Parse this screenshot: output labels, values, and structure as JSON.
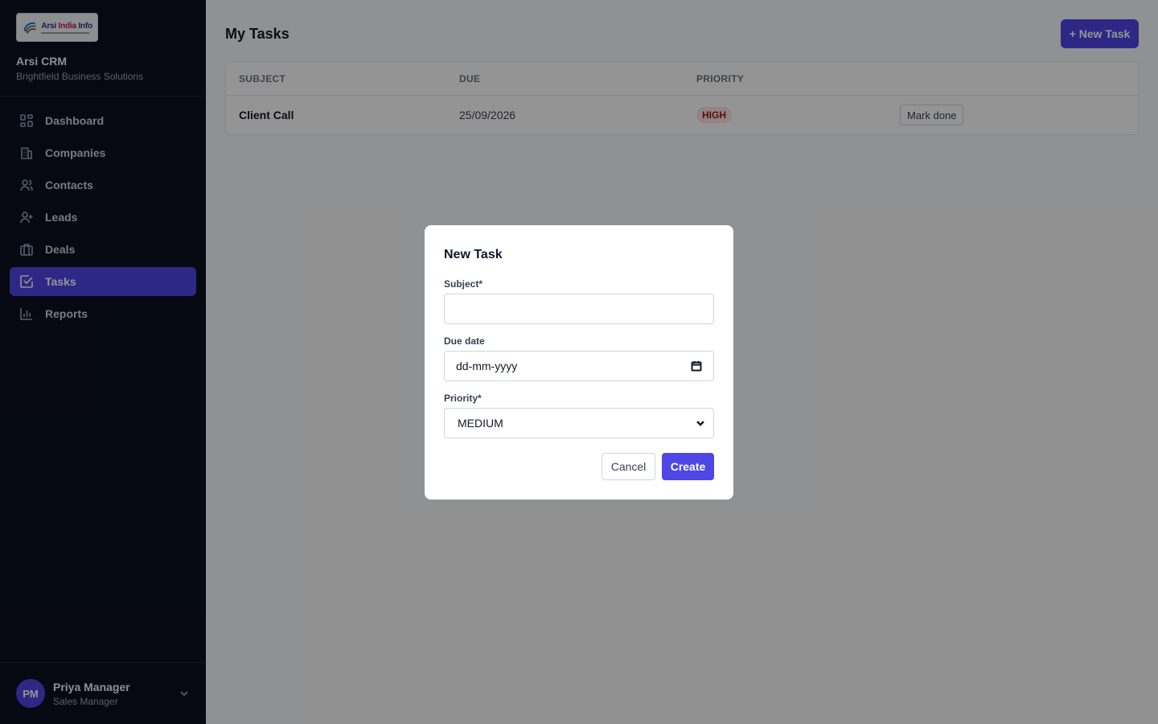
{
  "brand": {
    "logo_text_a": "Arsi ",
    "logo_text_b": "India",
    "logo_text_c": " Info",
    "name": "Arsi CRM",
    "subtitle": "Brightfield Business Solutions"
  },
  "sidebar": {
    "items": [
      {
        "label": "Dashboard",
        "icon": "dashboard-icon"
      },
      {
        "label": "Companies",
        "icon": "building-icon"
      },
      {
        "label": "Contacts",
        "icon": "users-icon"
      },
      {
        "label": "Leads",
        "icon": "user-plus-icon"
      },
      {
        "label": "Deals",
        "icon": "briefcase-icon"
      },
      {
        "label": "Tasks",
        "icon": "check-square-icon",
        "active": true
      },
      {
        "label": "Reports",
        "icon": "bar-chart-icon"
      }
    ]
  },
  "user": {
    "initials": "PM",
    "name": "Priya Manager",
    "role": "Sales Manager"
  },
  "main": {
    "title": "My Tasks",
    "new_task_label": "+ New Task",
    "columns": [
      "SUBJECT",
      "DUE",
      "PRIORITY"
    ],
    "rows": [
      {
        "subject": "Client Call",
        "due": "25/09/2026",
        "priority": "HIGH",
        "action": "Mark done"
      }
    ]
  },
  "modal": {
    "title": "New Task",
    "subject_label": "Subject*",
    "subject_value": "",
    "due_label": "Due date",
    "due_placeholder": "dd-mm-yyyy",
    "priority_label": "Priority*",
    "priority_value": "MEDIUM",
    "cancel_label": "Cancel",
    "create_label": "Create"
  },
  "colors": {
    "sidebar_bg": "#0b1120",
    "accent": "#4f46e5",
    "high_badge_bg": "#fee2e2",
    "high_badge_text": "#991b1b"
  }
}
